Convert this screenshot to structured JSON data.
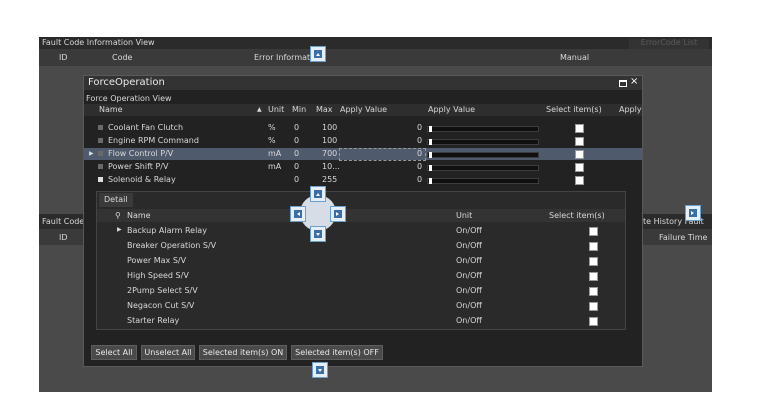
{
  "background_window": {
    "title": "Fault Code Information View",
    "errorcode_list_button": "ErrorCode List",
    "columns": {
      "id": "ID",
      "code": "Code",
      "error_info": "Error Informati",
      "manual": "Manual"
    },
    "lower_title": "Fault Code",
    "lower_right_tab": "te History Fault",
    "lower_id": "ID",
    "failure_time": "Failure Time"
  },
  "dialog": {
    "title": "ForceOperation",
    "restore_icon": "restore-icon",
    "close_label": "×",
    "subtitle": "Force Operation View",
    "columns": {
      "name": "Name",
      "unit": "Unit",
      "min": "Min",
      "max": "Max",
      "apply_value_1": "Apply Value",
      "apply_value_2": "Apply Value",
      "select": "Select item(s)",
      "apply": "Apply"
    },
    "rows": [
      {
        "name": "Coolant Fan Clutch",
        "unit": "%",
        "min": "0",
        "max": "100",
        "value": "0",
        "level": 0
      },
      {
        "name": "Engine RPM Command",
        "unit": "%",
        "min": "0",
        "max": "100",
        "value": "0",
        "level": 0
      },
      {
        "name": "Flow Control P/V",
        "unit": "mA",
        "min": "0",
        "max": "700",
        "value": "0",
        "level": 0
      },
      {
        "name": "Power Shift P/V",
        "unit": "mA",
        "min": "0",
        "max": "10...",
        "value": "0",
        "level": 0
      },
      {
        "name": "Solenoid & Relay",
        "unit": "",
        "min": "0",
        "max": "255",
        "value": "0",
        "level": 0
      }
    ],
    "detail": {
      "tab": "Detail",
      "columns": {
        "name": "Name",
        "unit": "Unit",
        "select": "Select item(s)"
      },
      "rows": [
        {
          "name": "Backup Alarm Relay",
          "unit": "On/Off"
        },
        {
          "name": "Breaker Operation S/V",
          "unit": "On/Off"
        },
        {
          "name": "Power Max S/V",
          "unit": "On/Off"
        },
        {
          "name": "High Speed S/V",
          "unit": "On/Off"
        },
        {
          "name": "2Pump Select S/V",
          "unit": "On/Off"
        },
        {
          "name": "Negacon Cut S/V",
          "unit": "On/Off"
        },
        {
          "name": "Starter Relay",
          "unit": "On/Off"
        }
      ]
    },
    "buttons": {
      "select_all": "Select All",
      "unselect_all": "Unselect All",
      "selected_on": "Selected item(s) ON",
      "selected_off": "Selected item(s) OFF"
    }
  },
  "colors": {
    "selected_row": "#4f5a6c",
    "dock_fill": "#e6eef6",
    "dock_border": "#6aa0d0"
  }
}
